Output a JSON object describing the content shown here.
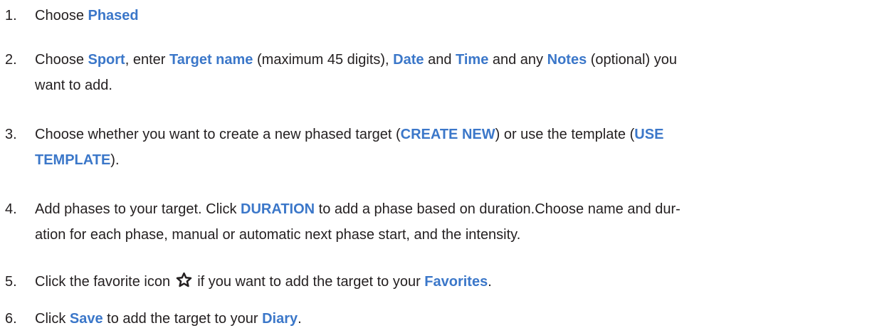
{
  "steps": [
    {
      "number": "1.",
      "parts": [
        {
          "t": "Choose "
        },
        {
          "t": "Phased",
          "kw": true
        }
      ]
    },
    {
      "number": "2.",
      "parts": [
        {
          "t": "Choose "
        },
        {
          "t": "Sport",
          "kw": true
        },
        {
          "t": ", enter "
        },
        {
          "t": "Target name",
          "kw": true
        },
        {
          "t": " (maximum 45 digits), "
        },
        {
          "t": "Date",
          "kw": true
        },
        {
          "t": " and "
        },
        {
          "t": "Time",
          "kw": true
        },
        {
          "t": " and any "
        },
        {
          "t": "Notes",
          "kw": true
        },
        {
          "t": " (optional) you"
        },
        {
          "br": true
        },
        {
          "t": "want to add."
        }
      ]
    },
    {
      "number": "3.",
      "parts": [
        {
          "t": "Choose whether you want to create a new phased target ("
        },
        {
          "t": "CREATE NEW",
          "kw": true
        },
        {
          "t": ") or use the template ("
        },
        {
          "t": "USE",
          "kw": true
        },
        {
          "br": true
        },
        {
          "t": "TEMPLATE",
          "kw": true
        },
        {
          "t": ")."
        }
      ]
    },
    {
      "number": "4.",
      "parts": [
        {
          "t": "Add phases to your target. Click "
        },
        {
          "t": "DURATION",
          "kw": true
        },
        {
          "t": " to add a phase based on duration.Choose name and dur-"
        },
        {
          "br": true
        },
        {
          "t": "ation for each phase, manual or automatic next phase start, and the intensity."
        }
      ]
    },
    {
      "number": "5.",
      "parts": [
        {
          "t": "Click the favorite icon "
        },
        {
          "icon": "star-icon"
        },
        {
          "t": " if you want to add the target to your "
        },
        {
          "t": "Favorites",
          "kw": true
        },
        {
          "t": "."
        }
      ]
    },
    {
      "number": "6.",
      "parts": [
        {
          "t": "Click "
        },
        {
          "t": "Save",
          "kw": true
        },
        {
          "t": " to add the target to your "
        },
        {
          "t": "Diary",
          "kw": true
        },
        {
          "t": "."
        }
      ]
    }
  ],
  "colors": {
    "text": "#231f20",
    "keyword": "#3b77c9"
  }
}
